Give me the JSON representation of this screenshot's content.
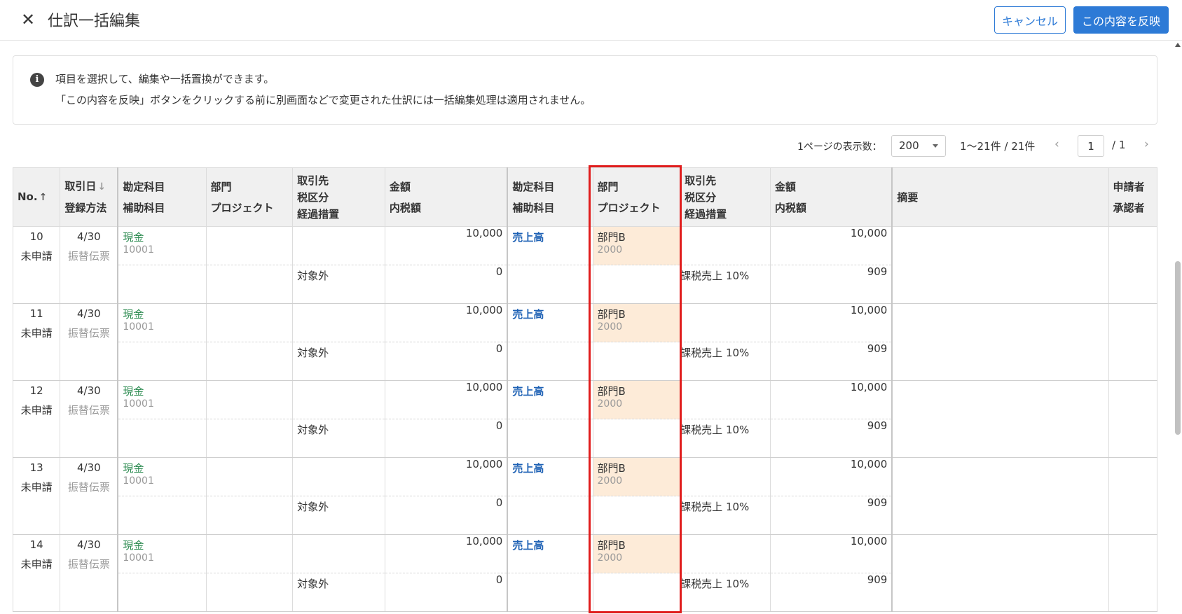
{
  "header": {
    "title": "仕訳一括編集",
    "close_icon": "close-icon",
    "cancel_label": "キャンセル",
    "apply_label": "この内容を反映"
  },
  "info": {
    "icon": "info-icon",
    "line1": "項目を選択して、編集や一括置換ができます。",
    "line2": "「この内容を反映」ボタンをクリックする前に別画面などで変更された仕訳には一括編集処理は適用されません。"
  },
  "pagination": {
    "per_page_label": "1ページの表示数：",
    "per_page_value": "200",
    "range": "1〜21件 / 21件",
    "current_page": "1",
    "of_pages": "/  1"
  },
  "columns": {
    "no": "No.",
    "date": "取引日",
    "method": "登録方法",
    "debit_account": "勘定科目",
    "debit_sub": "補助科目",
    "debit_dept": "部門",
    "debit_project": "プロジェクト",
    "debit_partner": "取引先",
    "debit_tax": "税区分",
    "debit_transition": "経過措置",
    "debit_amount": "金額",
    "debit_tax_amount": "内税額",
    "credit_account": "勘定科目",
    "credit_sub": "補助科目",
    "credit_dept": "部門",
    "credit_project": "プロジェクト",
    "credit_partner": "取引先",
    "credit_tax": "税区分",
    "credit_transition": "経過措置",
    "credit_amount": "金額",
    "credit_tax_amount": "内税額",
    "memo": "摘要",
    "applicant": "申請者",
    "approver": "承認者"
  },
  "rows": [
    {
      "no": "10",
      "status": "未申請",
      "date": "4/30",
      "method": "振替伝票",
      "debit_account": "現金",
      "debit_sub_code": "10001",
      "debit_tax": "対象外",
      "debit_amount": "10,000",
      "debit_tax_amount": "0",
      "credit_account": "売上高",
      "credit_dept": "部門B",
      "credit_dept_code": "2000",
      "credit_tax": "課税売上 10%",
      "credit_amount": "10,000",
      "credit_tax_amount": "909"
    },
    {
      "no": "11",
      "status": "未申請",
      "date": "4/30",
      "method": "振替伝票",
      "debit_account": "現金",
      "debit_sub_code": "10001",
      "debit_tax": "対象外",
      "debit_amount": "10,000",
      "debit_tax_amount": "0",
      "credit_account": "売上高",
      "credit_dept": "部門B",
      "credit_dept_code": "2000",
      "credit_tax": "課税売上 10%",
      "credit_amount": "10,000",
      "credit_tax_amount": "909"
    },
    {
      "no": "12",
      "status": "未申請",
      "date": "4/30",
      "method": "振替伝票",
      "debit_account": "現金",
      "debit_sub_code": "10001",
      "debit_tax": "対象外",
      "debit_amount": "10,000",
      "debit_tax_amount": "0",
      "credit_account": "売上高",
      "credit_dept": "部門B",
      "credit_dept_code": "2000",
      "credit_tax": "課税売上 10%",
      "credit_amount": "10,000",
      "credit_tax_amount": "909"
    },
    {
      "no": "13",
      "status": "未申請",
      "date": "4/30",
      "method": "振替伝票",
      "debit_account": "現金",
      "debit_sub_code": "10001",
      "debit_tax": "対象外",
      "debit_amount": "10,000",
      "debit_tax_amount": "0",
      "credit_account": "売上高",
      "credit_dept": "部門B",
      "credit_dept_code": "2000",
      "credit_tax": "課税売上 10%",
      "credit_amount": "10,000",
      "credit_tax_amount": "909"
    },
    {
      "no": "14",
      "status": "未申請",
      "date": "4/30",
      "method": "振替伝票",
      "debit_account": "現金",
      "debit_sub_code": "10001",
      "debit_tax": "対象外",
      "debit_amount": "10,000",
      "debit_tax_amount": "0",
      "credit_account": "売上高",
      "credit_dept": "部門B",
      "credit_dept_code": "2000",
      "credit_tax": "課税売上 10%",
      "credit_amount": "10,000",
      "credit_tax_amount": "909"
    }
  ],
  "colors": {
    "accent": "#2d7ad6",
    "highlight_cell": "#fdebd8",
    "annotation_box": "#e01d1d",
    "debit_account_text": "#2a8a4f",
    "credit_account_text": "#1f62b5"
  }
}
